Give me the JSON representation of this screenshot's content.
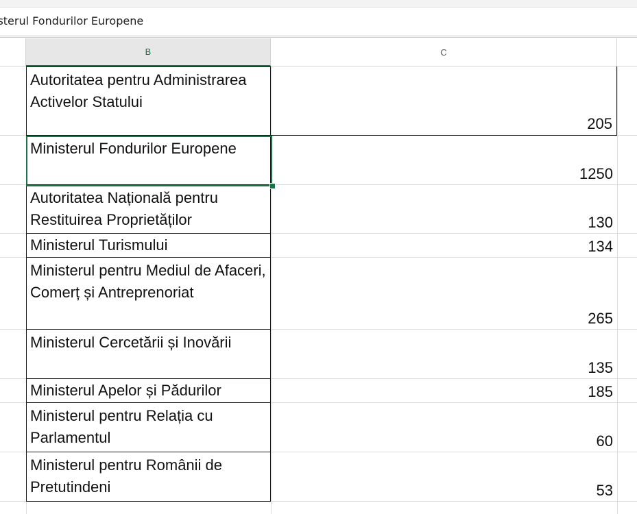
{
  "formula_bar": {
    "text": "isterul Fondurilor Europene"
  },
  "columns": {
    "b": "B",
    "c": "C"
  },
  "rows": [
    {
      "name": "Autoritatea pentru Administrarea Activelor Statului",
      "value": "205"
    },
    {
      "name": "Ministerul Fondurilor Europene",
      "value": "1250"
    },
    {
      "name": "Autoritatea Națională pentru Restituirea Proprietăților",
      "value": "130"
    },
    {
      "name": "Ministerul Turismului",
      "value": "134"
    },
    {
      "name": "Ministerul pentru Mediul de Afaceri, Comerț și Antreprenoriat",
      "value": "265"
    },
    {
      "name": "Ministerul Cercetării și Inovării",
      "value": "135"
    },
    {
      "name": "Ministerul Apelor și Pădurilor",
      "value": "185"
    },
    {
      "name": "Ministerul pentru Relația cu Parlamentul",
      "value": "60"
    },
    {
      "name": "Ministerul pentru Românii de Pretutindeni",
      "value": "53"
    }
  ],
  "colors": {
    "selection": "#1e7145",
    "grid": "#dcdcdc"
  }
}
